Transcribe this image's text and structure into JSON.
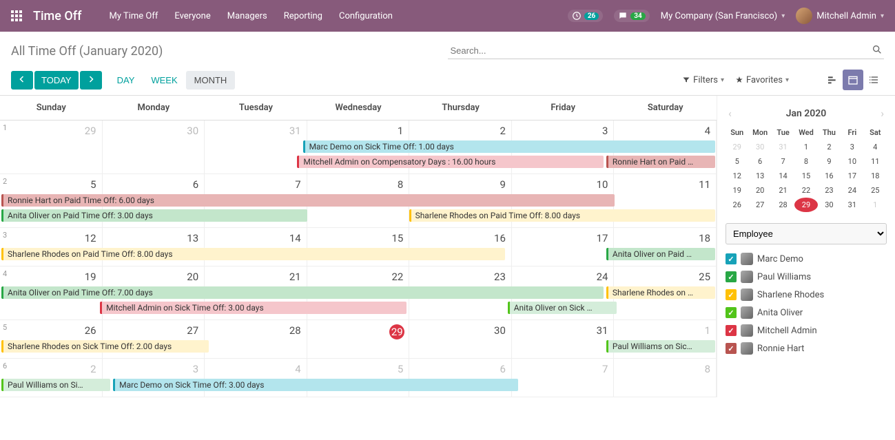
{
  "nav": {
    "brand": "Time Off",
    "links": [
      "My Time Off",
      "Everyone",
      "Managers",
      "Reporting",
      "Configuration"
    ],
    "badge1": "26",
    "badge2": "34",
    "company": "My Company (San Francisco)",
    "user": "Mitchell Admin"
  },
  "cp": {
    "breadcrumb": "All Time Off (January 2020)",
    "search_placeholder": "Search...",
    "today": "TODAY",
    "scales": [
      "DAY",
      "WEEK",
      "MONTH"
    ],
    "filters": "Filters",
    "favorites": "Favorites"
  },
  "cal": {
    "dows": [
      "Sunday",
      "Monday",
      "Tuesday",
      "Wednesday",
      "Thursday",
      "Friday",
      "Saturday"
    ],
    "weeks": [
      {
        "num": "1",
        "days": [
          {
            "n": "29",
            "o": true
          },
          {
            "n": "30",
            "o": true
          },
          {
            "n": "31",
            "o": true
          },
          {
            "n": "1"
          },
          {
            "n": "2"
          },
          {
            "n": "3"
          },
          {
            "n": "4"
          }
        ]
      },
      {
        "num": "2",
        "days": [
          {
            "n": "5"
          },
          {
            "n": "6"
          },
          {
            "n": "7"
          },
          {
            "n": "8"
          },
          {
            "n": "9"
          },
          {
            "n": "10"
          },
          {
            "n": "11"
          }
        ]
      },
      {
        "num": "3",
        "days": [
          {
            "n": "12"
          },
          {
            "n": "13"
          },
          {
            "n": "14"
          },
          {
            "n": "15"
          },
          {
            "n": "16"
          },
          {
            "n": "17"
          },
          {
            "n": "18"
          }
        ]
      },
      {
        "num": "4",
        "days": [
          {
            "n": "19"
          },
          {
            "n": "20"
          },
          {
            "n": "21"
          },
          {
            "n": "22"
          },
          {
            "n": "23"
          },
          {
            "n": "24"
          },
          {
            "n": "25"
          }
        ]
      },
      {
        "num": "5",
        "days": [
          {
            "n": "26"
          },
          {
            "n": "27"
          },
          {
            "n": "28"
          },
          {
            "n": "29",
            "t": true
          },
          {
            "n": "30"
          },
          {
            "n": "31"
          },
          {
            "n": "1",
            "o": true
          }
        ]
      },
      {
        "num": "6",
        "days": [
          {
            "n": "2",
            "o": true
          },
          {
            "n": "3",
            "o": true
          },
          {
            "n": "4",
            "o": true
          },
          {
            "n": "5",
            "o": true
          },
          {
            "n": "6",
            "o": true
          },
          {
            "n": "7",
            "o": true
          },
          {
            "n": "8",
            "o": true
          }
        ]
      }
    ],
    "events": {
      "w0": [
        {
          "text": "Marc Demo on Sick Time Off: 1.00 days",
          "cls": "e-blue",
          "start": 3,
          "span": 4,
          "row": 0
        },
        {
          "text": "Mitchell Admin on Compensatory Days : 16.00 hours",
          "cls": "e-red",
          "start": 3,
          "span": 3,
          "row": 1
        },
        {
          "text": "Ronnie Hart on Paid …",
          "cls": "e-dred",
          "start": 6,
          "span": 1,
          "row": 1
        }
      ],
      "w1": [
        {
          "text": "Ronnie Hart on Paid Time Off: 6.00 days",
          "cls": "e-dred",
          "start": 0,
          "span": 6,
          "row": 0
        },
        {
          "text": "Anita Oliver on Paid Time Off: 3.00 days",
          "cls": "e-green",
          "start": 0,
          "span": 3,
          "row": 1
        },
        {
          "text": "Sharlene Rhodes on Paid Time Off: 8.00 days",
          "cls": "e-yellow",
          "start": 4,
          "span": 3,
          "row": 1
        }
      ],
      "w2": [
        {
          "text": "Sharlene Rhodes on Paid Time Off: 8.00 days",
          "cls": "e-yellow",
          "start": 0,
          "span": 5,
          "row": 0
        },
        {
          "text": "Anita Oliver on Paid …",
          "cls": "e-green",
          "start": 6,
          "span": 1,
          "row": 0
        }
      ],
      "w3": [
        {
          "text": "Anita Oliver on Paid Time Off: 7.00 days",
          "cls": "e-green",
          "start": 0,
          "span": 6,
          "row": 0
        },
        {
          "text": "Sharlene Rhodes on …",
          "cls": "e-yellow",
          "start": 6,
          "span": 1,
          "row": 0
        },
        {
          "text": "Mitchell Admin on Sick Time Off: 3.00 days",
          "cls": "e-red",
          "start": 1,
          "span": 3,
          "row": 1
        },
        {
          "text": "Anita Oliver on Sick …",
          "cls": "e-lgreen",
          "start": 5,
          "span": 1,
          "row": 1
        }
      ],
      "w4": [
        {
          "text": "Sharlene Rhodes on Sick Time Off: 2.00 days",
          "cls": "e-yellow",
          "start": 0,
          "span": 2,
          "row": 0
        },
        {
          "text": "Paul Williams on Sic…",
          "cls": "e-lgreen",
          "start": 6,
          "span": 1,
          "row": 0
        }
      ],
      "w5": [
        {
          "text": "Paul Williams on Si…",
          "cls": "e-lgreen",
          "start": 0,
          "span": 1,
          "row": 0
        },
        {
          "text": "Marc Demo on Sick Time Off: 3.00 days",
          "cls": "e-blue",
          "start": 1,
          "span": 4,
          "row": 0
        }
      ]
    }
  },
  "mini": {
    "title": "Jan 2020",
    "dows": [
      "Sun",
      "Mon",
      "Tue",
      "Wed",
      "Thu",
      "Fri",
      "Sat"
    ],
    "days": [
      {
        "n": "29",
        "o": true
      },
      {
        "n": "30",
        "o": true
      },
      {
        "n": "31",
        "o": true
      },
      {
        "n": "1"
      },
      {
        "n": "2"
      },
      {
        "n": "3"
      },
      {
        "n": "4"
      },
      {
        "n": "5"
      },
      {
        "n": "6"
      },
      {
        "n": "7"
      },
      {
        "n": "8"
      },
      {
        "n": "9"
      },
      {
        "n": "10"
      },
      {
        "n": "11"
      },
      {
        "n": "12"
      },
      {
        "n": "13"
      },
      {
        "n": "14"
      },
      {
        "n": "15"
      },
      {
        "n": "16"
      },
      {
        "n": "17"
      },
      {
        "n": "18"
      },
      {
        "n": "19"
      },
      {
        "n": "20"
      },
      {
        "n": "21"
      },
      {
        "n": "22"
      },
      {
        "n": "23"
      },
      {
        "n": "24"
      },
      {
        "n": "25"
      },
      {
        "n": "26"
      },
      {
        "n": "27"
      },
      {
        "n": "28"
      },
      {
        "n": "29",
        "t": true
      },
      {
        "n": "30"
      },
      {
        "n": "31"
      },
      {
        "n": "1",
        "o": true
      }
    ]
  },
  "filter": {
    "placeholder": "Employee",
    "employees": [
      {
        "name": "Marc Demo",
        "color": "blue"
      },
      {
        "name": "Paul Williams",
        "color": "green"
      },
      {
        "name": "Sharlene Rhodes",
        "color": "yellow"
      },
      {
        "name": "Anita Oliver",
        "color": "lgreen"
      },
      {
        "name": "Mitchell Admin",
        "color": "red"
      },
      {
        "name": "Ronnie Hart",
        "color": "dred"
      }
    ]
  }
}
